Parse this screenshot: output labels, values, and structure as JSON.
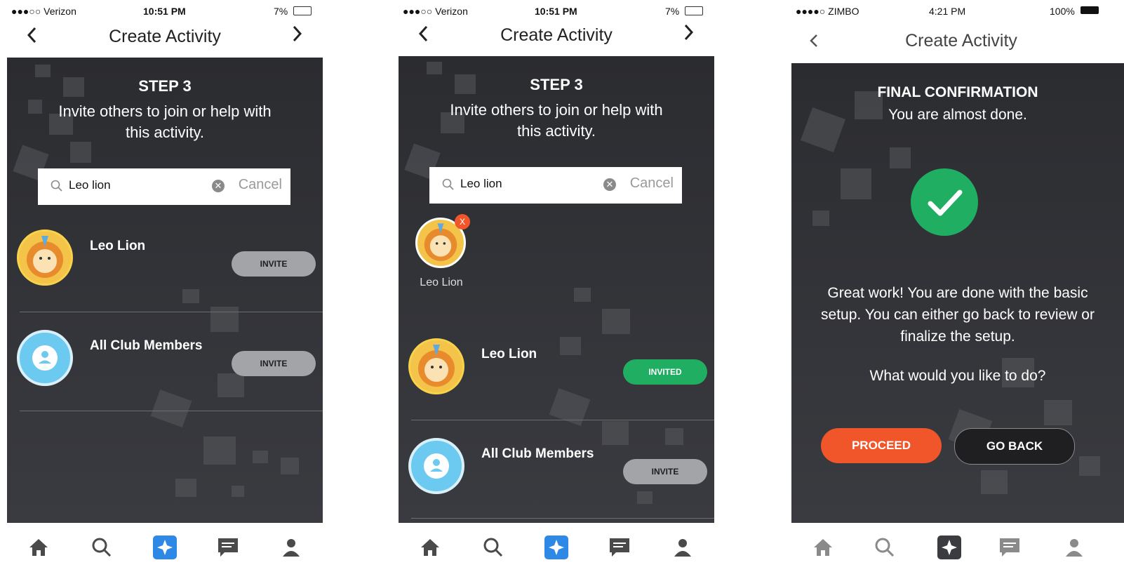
{
  "screens": [
    {
      "status": {
        "carrier": "●●●○○ Verizon",
        "time": "10:51 PM",
        "battery": "7%"
      },
      "nav": {
        "title": "Create Activity",
        "back_icon": "chevron-left-icon",
        "next_icon": "chevron-right-icon"
      },
      "step": {
        "title": "STEP 3",
        "subtitle": "Invite others to join or help with this activity."
      },
      "search": {
        "value": "Leo lion",
        "cancel": "Cancel"
      },
      "rows": [
        {
          "name": "Leo Lion",
          "action": "INVITE"
        },
        {
          "name": "All Club Members",
          "action": "INVITE"
        }
      ]
    },
    {
      "status": {
        "carrier": "●●●○○ Verizon",
        "time": "10:51 PM",
        "battery": "7%"
      },
      "nav": {
        "title": "Create Activity"
      },
      "step": {
        "title": "STEP 3",
        "subtitle": "Invite others to join or help with this activity."
      },
      "search": {
        "value": "Leo lion",
        "cancel": "Cancel"
      },
      "selected": {
        "name": "Leo Lion",
        "remove": "X"
      },
      "rows": [
        {
          "name": "Leo Lion",
          "action": "INVITED"
        },
        {
          "name": "All Club Members",
          "action": "INVITE"
        }
      ]
    },
    {
      "status": {
        "carrier": "●●●●○ ZIMBO",
        "time": "4:21 PM",
        "battery": "100%"
      },
      "nav": {
        "title": "Create Activity"
      },
      "confirm": {
        "title": "FINAL CONFIRMATION",
        "subtitle": "You are almost done.",
        "body": "Great work! You are done with the basic setup. You can either go back to review or finalize the setup.",
        "question": "What would you like to do?",
        "proceed": "PROCEED",
        "go_back": "GO BACK"
      }
    }
  ],
  "tabs": [
    "home-icon",
    "search-icon",
    "activity-icon",
    "messages-icon",
    "profile-icon"
  ],
  "colors": {
    "accent_blue": "#2e89e6",
    "invited_green": "#1fae62",
    "proceed_orange": "#f0562a",
    "success_green": "#1fae62"
  }
}
